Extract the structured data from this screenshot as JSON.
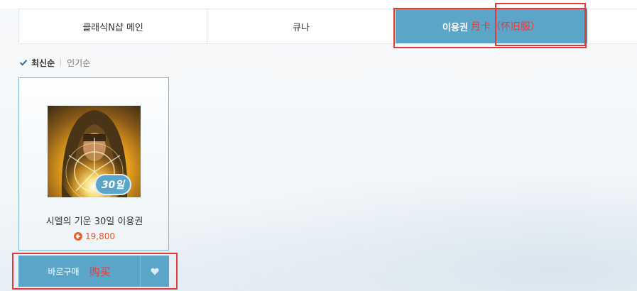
{
  "tabs": [
    {
      "label": "클래식N샵 메인"
    },
    {
      "label": "큐나"
    },
    {
      "label": "이용권",
      "note": "月卡（怀旧服）"
    }
  ],
  "sort": {
    "active": "최신순",
    "other": "인기순"
  },
  "product": {
    "name": "시엘의 기운 30일 이용권",
    "badge": "30일",
    "price": "19,800"
  },
  "actions": {
    "buy_label": "바로구매",
    "buy_note": "购买"
  },
  "colors": {
    "accent": "#5ba6c8",
    "price": "#e05a2b",
    "annotation": "#e23a3a"
  }
}
